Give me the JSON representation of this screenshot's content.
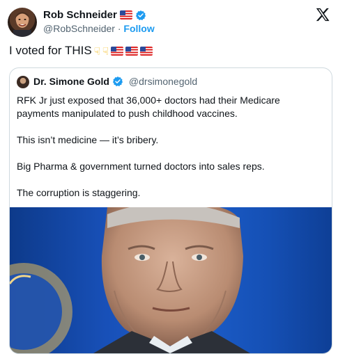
{
  "author": {
    "name": "Rob Schneider",
    "handle": "@RobSchneider",
    "separator": "·",
    "follow_label": "Follow"
  },
  "tweet": {
    "text": "I voted for THIS"
  },
  "icons": {
    "logo": "x-logo-icon",
    "verified": "verified-badge-icon",
    "flag": "us-flag-icon",
    "hand": "pointing-down-icon"
  },
  "quoted": {
    "name": "Dr. Simone Gold",
    "handle": "@drsimonegold",
    "paragraphs": [
      "RFK Jr just exposed that 36,000+ doctors had their Medicare payments manipulated to push childhood vaccines.",
      "This isn’t medicine — it’s bribery.",
      "Big Pharma & government turned doctors into sales reps.",
      "The corruption is staggering."
    ]
  },
  "colors": {
    "accent": "#1d9bf0",
    "text": "#0f1419",
    "muted": "#536471",
    "border": "#cfd9de"
  }
}
